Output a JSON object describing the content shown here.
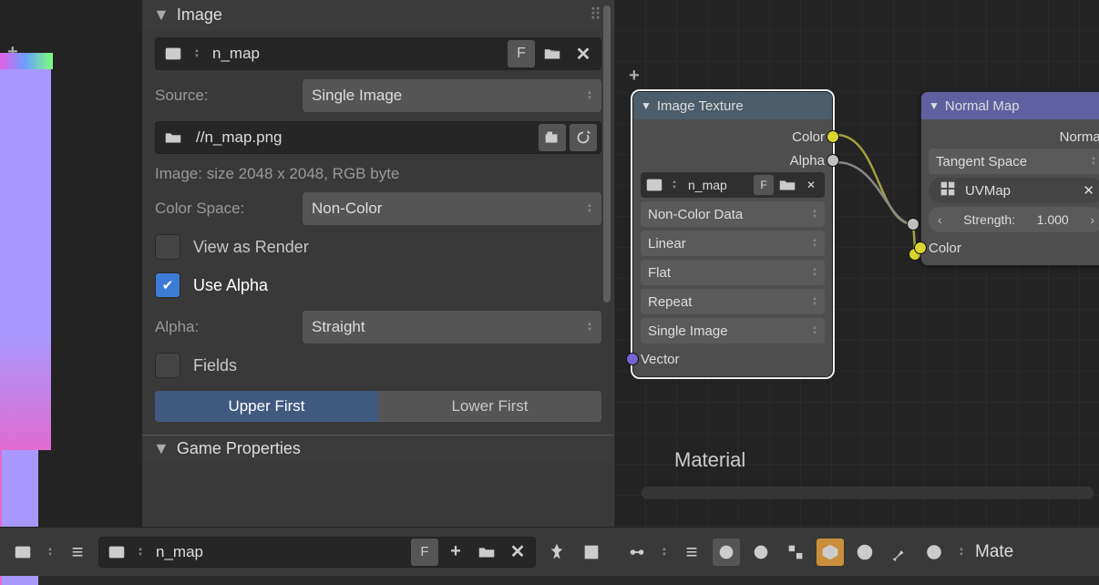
{
  "panel": {
    "image_header": "Image",
    "game_props_header": "Game Properties",
    "image_name": "n_map",
    "fake_user_label": "F",
    "source_label": "Source:",
    "source_value": "Single Image",
    "filepath": "//n_map.png",
    "info": "Image: size 2048 x 2048, RGB byte",
    "colorspace_label": "Color Space:",
    "colorspace_value": "Non-Color",
    "view_as_render": "View as Render",
    "use_alpha": "Use Alpha",
    "alpha_label": "Alpha:",
    "alpha_value": "Straight",
    "fields": "Fields",
    "upper_first": "Upper First",
    "lower_first": "Lower First"
  },
  "nodes": {
    "image_texture": {
      "title": "Image Texture",
      "out_color": "Color",
      "out_alpha": "Alpha",
      "image_name": "n_map",
      "fake_user": "F",
      "color_space": "Non-Color Data",
      "interpolation": "Linear",
      "projection": "Flat",
      "extension": "Repeat",
      "source": "Single Image",
      "in_vector": "Vector"
    },
    "normal_map": {
      "title": "Normal Map",
      "out_normal": "Normal",
      "space": "Tangent Space",
      "uvmap": "UVMap",
      "strength_label": "Strength:",
      "strength_value": "1.000",
      "in_color": "Color"
    }
  },
  "viewport": {
    "material_label": "Material"
  },
  "bottom_left": {
    "image_name": "n_map",
    "fake_user": "F"
  },
  "bottom_right": {
    "mat_label": "Mate"
  }
}
